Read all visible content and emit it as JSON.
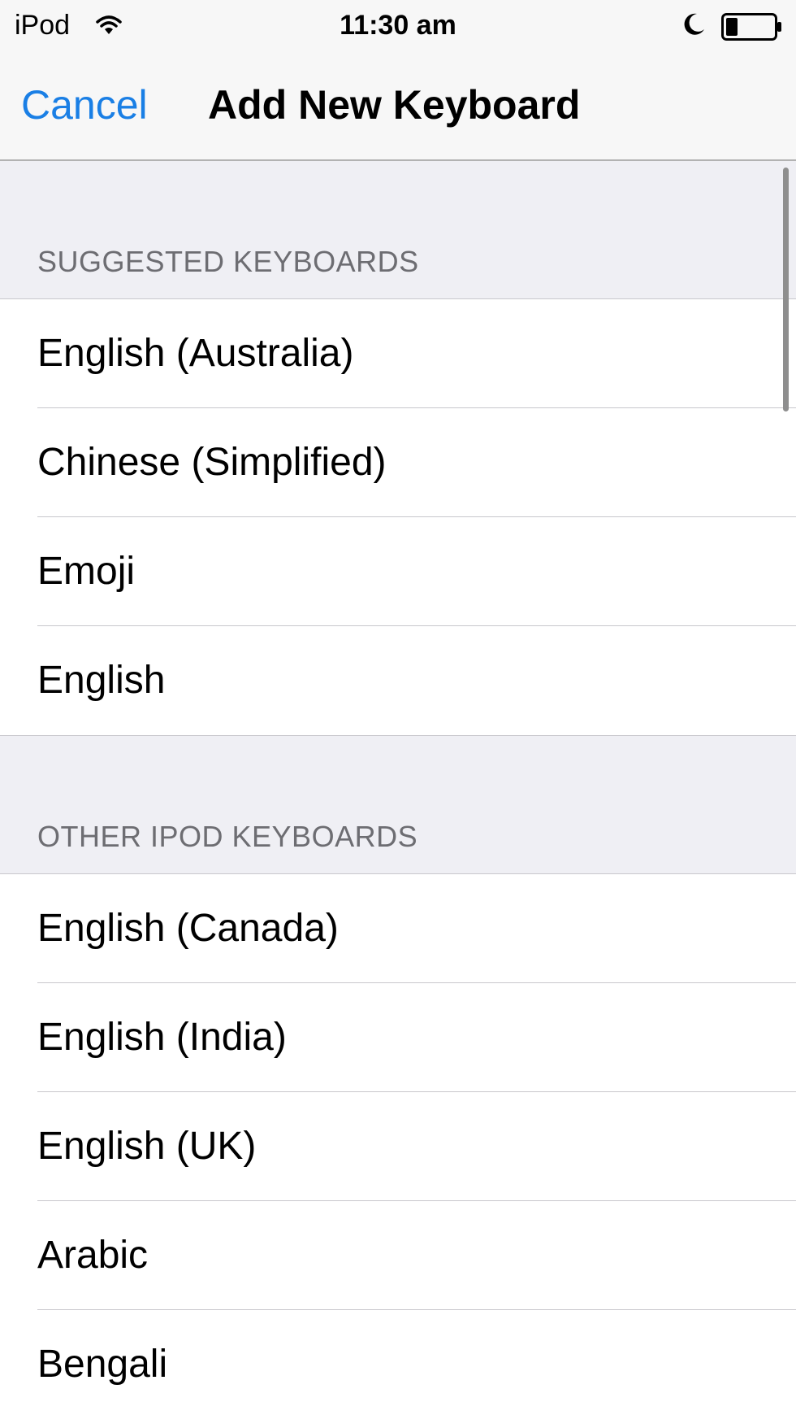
{
  "status_bar": {
    "carrier": "iPod",
    "time": "11:30 am",
    "icons": [
      "wifi-icon",
      "moon-icon",
      "battery-icon"
    ]
  },
  "nav_bar": {
    "cancel_label": "Cancel",
    "title": "Add New Keyboard"
  },
  "sections": [
    {
      "header": "SUGGESTED KEYBOARDS",
      "items": [
        {
          "label": "English (Australia)"
        },
        {
          "label": "Chinese (Simplified)"
        },
        {
          "label": "Emoji"
        },
        {
          "label": "English"
        }
      ]
    },
    {
      "header": "OTHER IPOD KEYBOARDS",
      "items": [
        {
          "label": "English (Canada)"
        },
        {
          "label": "English (India)"
        },
        {
          "label": "English (UK)"
        },
        {
          "label": "Arabic"
        },
        {
          "label": "Bengali"
        }
      ]
    }
  ],
  "colors": {
    "accent": "#1a7fe5",
    "group_background": "#efeff4",
    "section_header_text": "#6d6d72",
    "separator": "#c8c7cc"
  }
}
